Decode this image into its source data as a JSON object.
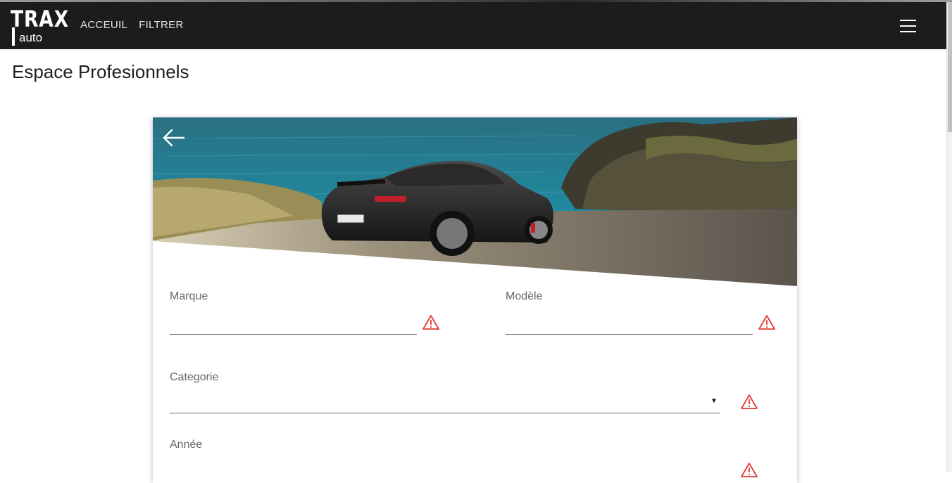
{
  "brand": {
    "logo_main": "TRAX",
    "logo_sub": "auto"
  },
  "nav": {
    "items": [
      {
        "label": "ACCEUIL"
      },
      {
        "label": "FILTRER"
      }
    ]
  },
  "page": {
    "title": "Espace Profesionnels"
  },
  "form": {
    "fields": {
      "marque": {
        "label": "Marque",
        "value": ""
      },
      "modele": {
        "label": "Modèle",
        "value": ""
      },
      "categorie": {
        "label": "Categorie",
        "value": ""
      },
      "annee": {
        "label": "Année",
        "value": ""
      }
    }
  },
  "icons": {
    "back": "arrow-left-icon",
    "menu": "hamburger-menu-icon",
    "warning": "warning-triangle-icon"
  },
  "colors": {
    "navbar": "#1c1c1c",
    "warning": "#e53935"
  }
}
